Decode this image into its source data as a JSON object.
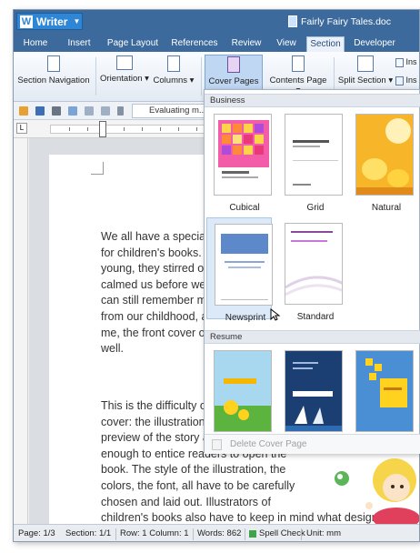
{
  "app": {
    "name": "Writer",
    "doc_title": "Fairly Fairy Tales.doc"
  },
  "tabs": [
    "Home",
    "Insert",
    "Page Layout",
    "References",
    "Review",
    "View",
    "Section",
    "Developer"
  ],
  "ribbon": {
    "section_navigation": "Section Navigation",
    "orientation": "Orientation",
    "columns": "Columns",
    "cover_pages": "Cover Pages",
    "contents_page": "Contents Page",
    "split_section": "Split Section",
    "ins1": "Ins",
    "ins2": "Ins"
  },
  "quick_access": {
    "tab_label": "Evaluating m..."
  },
  "gallery": {
    "business_header": "Business",
    "resume_header": "Resume",
    "items": [
      "Cubical",
      "Grid",
      "Natural",
      "Newsprint",
      "Standard"
    ],
    "footer": "Delete Cover Page"
  },
  "document": {
    "para1": [
      "We all have a special",
      "for children's books. V",
      "young, they stirred ou",
      "calmed us before we",
      "can still remember m",
      "from our childhood, a",
      "me, the front cover o",
      "well."
    ],
    "para2": [
      "This is the difficulty o",
      "cover: the illustration",
      "preview of the story a",
      "enough to entice readers to open the",
      "book. The style of the illustration, the",
      "colors, the font, all have to be carefully",
      "chosen and laid out. Illustrators of",
      "children's books also have to keep in mind what designs will appeal"
    ]
  },
  "status": {
    "page": "Page: 1/3",
    "section": "Section: 1/1",
    "rowcol": "Row: 1 Column: 1",
    "words": "Words: 862",
    "spell": "Spell Check",
    "unit": "Unit: mm"
  }
}
